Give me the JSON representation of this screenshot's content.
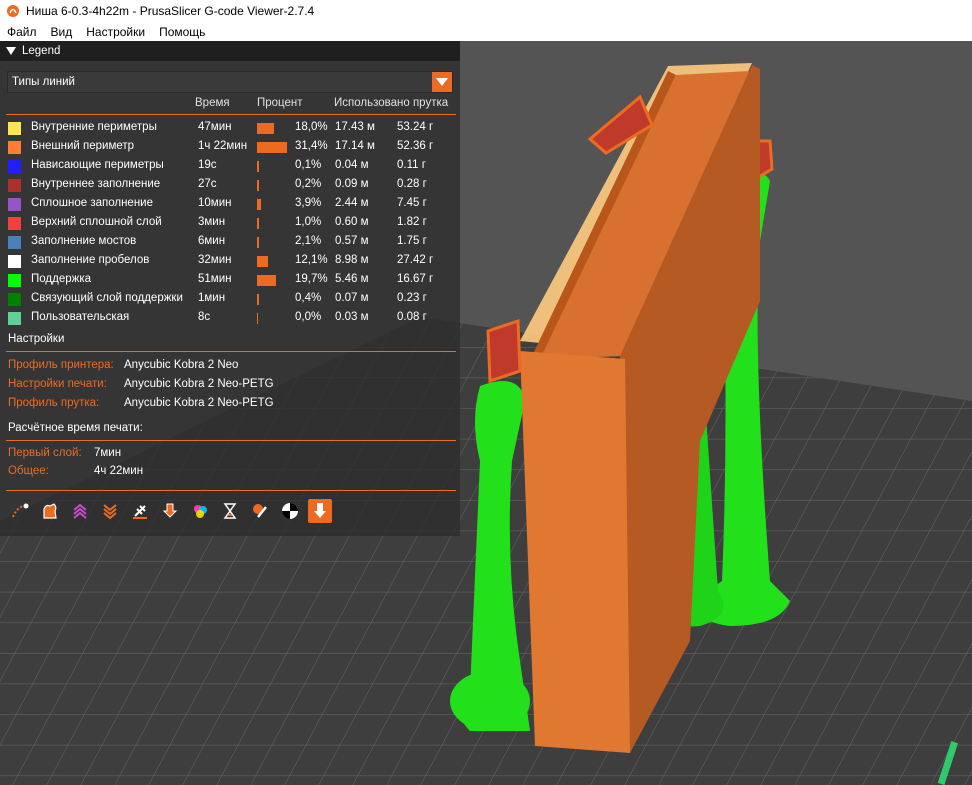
{
  "window": {
    "title": "Ниша 6-0.3-4h22m - PrusaSlicer G-code Viewer-2.7.4"
  },
  "menu": [
    "Файл",
    "Вид",
    "Настройки",
    "Помощь"
  ],
  "legend": {
    "header": "Legend",
    "view_type": "Типы линий",
    "columns": {
      "time": "Время",
      "percent": "Процент",
      "used": "Использовано прутка"
    },
    "rows": [
      {
        "name": "Внутренние периметры",
        "color": "#ffe650",
        "time": "47мин",
        "percent": "18,0%",
        "fraction": 0.18,
        "length": "17.43 м",
        "weight": "53.24 г"
      },
      {
        "name": "Внешний периметр",
        "color": "#ff7d38",
        "time": "1ч 22мин",
        "percent": "31,4%",
        "fraction": 0.314,
        "length": "17.14 м",
        "weight": "52.36 г"
      },
      {
        "name": "Нависающие периметры",
        "color": "#1f1fff",
        "time": "19с",
        "percent": "0,1%",
        "fraction": 0.001,
        "length": "0.04 м",
        "weight": "0.11 г"
      },
      {
        "name": "Внутреннее заполнение",
        "color": "#b03029",
        "time": "27с",
        "percent": "0,2%",
        "fraction": 0.002,
        "length": "0.09 м",
        "weight": "0.28 г"
      },
      {
        "name": "Сплошное заполнение",
        "color": "#9654cc",
        "time": "10мин",
        "percent": "3,9%",
        "fraction": 0.039,
        "length": "2.44 м",
        "weight": "7.45 г"
      },
      {
        "name": "Верхний сплошной слой",
        "color": "#f04040",
        "time": "3мин",
        "percent": "1,0%",
        "fraction": 0.01,
        "length": "0.60 м",
        "weight": "1.82 г"
      },
      {
        "name": "Заполнение мостов",
        "color": "#4d80ba",
        "time": "6мин",
        "percent": "2,1%",
        "fraction": 0.021,
        "length": "0.57 м",
        "weight": "1.75 г"
      },
      {
        "name": "Заполнение пробелов",
        "color": "#ffffff",
        "time": "32мин",
        "percent": "12,1%",
        "fraction": 0.121,
        "length": "8.98 м",
        "weight": "27.42 г"
      },
      {
        "name": "Поддержка",
        "color": "#00ff00",
        "time": "51мин",
        "percent": "19,7%",
        "fraction": 0.197,
        "length": "5.46 м",
        "weight": "16.67 г"
      },
      {
        "name": "Связующий слой поддержки",
        "color": "#008000",
        "time": "1мин",
        "percent": "0,4%",
        "fraction": 0.004,
        "length": "0.07 м",
        "weight": "0.23 г"
      },
      {
        "name": "Пользовательская",
        "color": "#5ed195",
        "time": "8с",
        "percent": "0,0%",
        "fraction": 0.0,
        "length": "0.03 м",
        "weight": "0.08 г"
      }
    ],
    "settings": {
      "title": "Настройки",
      "printer_label": "Профиль принтера:",
      "printer_value": "Anycubic Kobra 2 Neo",
      "print_label": "Настройки печати:",
      "print_value": "Anycubic Kobra 2 Neo-PETG",
      "filament_label": "Профиль прутка:",
      "filament_value": "Anycubic Kobra 2 Neo-PETG"
    },
    "estimate": {
      "title": "Расчётное время печати:",
      "first_layer_label": "Первый слой:",
      "first_layer_value": "7мин",
      "total_label": "Общее:",
      "total_value": "4ч 22мин"
    },
    "toolbar_icons": [
      "travel-icon",
      "wipe-icon",
      "retractions-icon",
      "deretractions-icon",
      "seams-icon",
      "tool-changes-icon",
      "color-changes-icon",
      "pause-prints-icon",
      "custom-gcodes-icon",
      "center-of-gravity-icon",
      "shells-icon"
    ]
  },
  "colors": {
    "accent": "#ed6b21",
    "model": "#d9742e",
    "support": "#22e01a"
  }
}
